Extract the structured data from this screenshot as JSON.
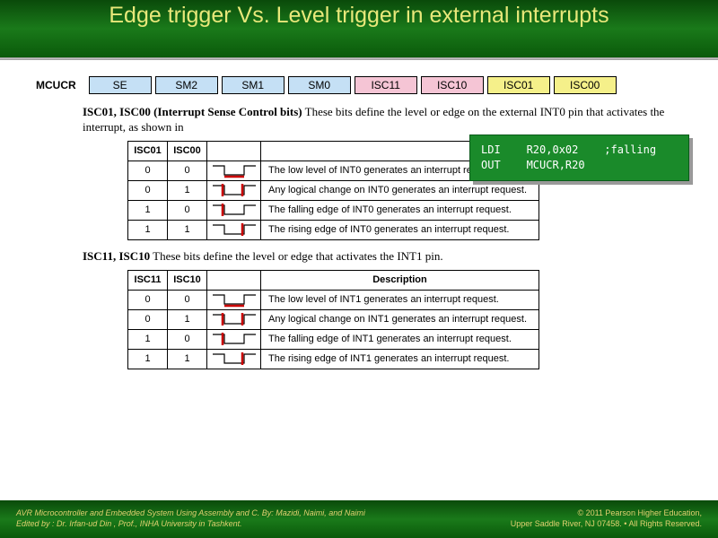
{
  "title": "Edge trigger Vs. Level trigger in external interrupts",
  "register": {
    "name": "MCUCR",
    "bits": [
      {
        "label": "SE",
        "color": "c-blue"
      },
      {
        "label": "SM2",
        "color": "c-blue"
      },
      {
        "label": "SM1",
        "color": "c-blue"
      },
      {
        "label": "SM0",
        "color": "c-blue"
      },
      {
        "label": "ISC11",
        "color": "c-pink"
      },
      {
        "label": "ISC10",
        "color": "c-pink"
      },
      {
        "label": "ISC01",
        "color": "c-yellow"
      },
      {
        "label": "ISC00",
        "color": "c-yellow"
      }
    ]
  },
  "desc0": {
    "bold": "ISC01, ISC00 (Interrupt Sense Control bits)",
    "rest": "  These bits define the level or edge on the external INT0 pin that activates the interrupt, as shown in"
  },
  "table0": {
    "h0": "ISC01",
    "h1": "ISC00",
    "rows": [
      {
        "a": "0",
        "b": "0",
        "d": "The low level of INT0 generates an interrupt request."
      },
      {
        "a": "0",
        "b": "1",
        "d": "Any logical change on INT0 generates an interrupt request."
      },
      {
        "a": "1",
        "b": "0",
        "d": "The falling edge of INT0 generates an interrupt request."
      },
      {
        "a": "1",
        "b": "1",
        "d": "The rising edge of INT0 generates an interrupt request."
      }
    ]
  },
  "desc1": {
    "bold": "ISC11, ISC10",
    "rest": "  These bits define the level or edge that activates the INT1 pin."
  },
  "table1": {
    "h0": "ISC11",
    "h1": "ISC10",
    "h3": "Description",
    "rows": [
      {
        "a": "0",
        "b": "0",
        "d": "The low level of INT1 generates an interrupt request."
      },
      {
        "a": "0",
        "b": "1",
        "d": "Any logical change on INT1 generates an interrupt request."
      },
      {
        "a": "1",
        "b": "0",
        "d": "The falling edge of INT1 generates an interrupt request."
      },
      {
        "a": "1",
        "b": "1",
        "d": "The rising edge of INT1 generates an interrupt request."
      }
    ]
  },
  "code": "LDI    R20,0x02    ;falling\nOUT    MCUCR,R20",
  "footer": {
    "left1": "AVR Microcontroller and Embedded System Using Assembly and C.   By: Mazidi, Naimi, and Naimi",
    "left2": "Edited  by :  Dr. Irfan-ud Din , Prof., INHA University in Tashkent.",
    "right1": "© 2011   Pearson Higher Education,",
    "right2": "Upper Saddle River, NJ 07458. • All Rights Reserved."
  }
}
